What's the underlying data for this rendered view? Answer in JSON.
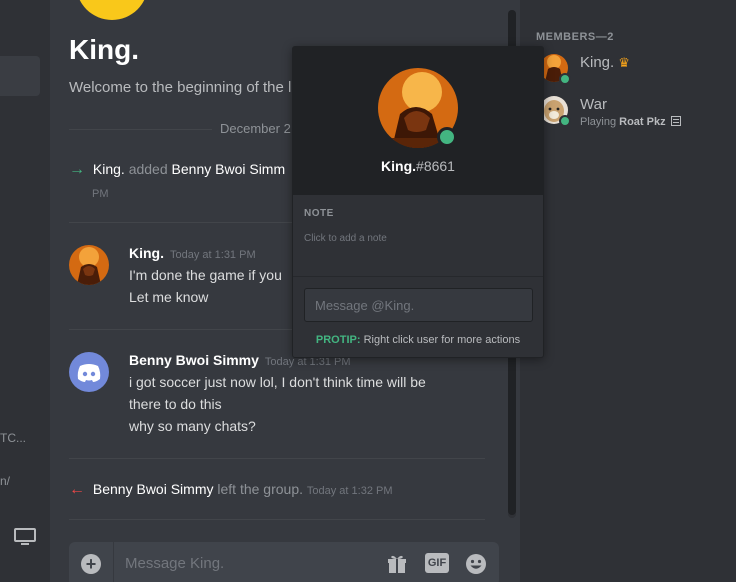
{
  "left_strip": {
    "frag1": "TC...",
    "frag2": "n/"
  },
  "channel": {
    "title": "King.",
    "welcome": "Welcome to the beginning of the l",
    "date_divider": "December 2"
  },
  "system_messages": [
    {
      "arrow": "→",
      "who": "King.",
      "action": "added",
      "target": "Benny Bwoi Simm",
      "time_tail": "PM"
    },
    {
      "arrow": "←",
      "who": "Benny Bwoi Simmy",
      "action": "left the group.",
      "time": "Today at 1:32 PM"
    }
  ],
  "messages": [
    {
      "author": "King.",
      "time": "Today at 1:31 PM",
      "lines": [
        "I'm done the game if you",
        "Let me know"
      ]
    },
    {
      "author": "Benny Bwoi Simmy",
      "time": "Today at 1:31 PM",
      "lines": [
        "i got soccer just now lol, I don't think time will be",
        "there to do this",
        "why so many chats?"
      ]
    }
  ],
  "composer": {
    "placeholder": "Message King.",
    "gif_label": "GIF",
    "plus_icon": "+"
  },
  "members": {
    "header": "MEMBERS—2",
    "list": [
      {
        "name": "King.",
        "badge": "♛"
      },
      {
        "name": "War",
        "activity_prefix": "Playing",
        "activity_game": "Roat Pkz"
      }
    ]
  },
  "popout": {
    "username": "King.",
    "discriminator": "#8661",
    "note_header": "NOTE",
    "note_placeholder": "Click to add a note",
    "message_placeholder": "Message @King.",
    "protip_label": "PROTIP:",
    "protip_text": " Right click user for more actions"
  },
  "colors": {
    "online": "#43b581",
    "background": "#36393f",
    "sidebar": "#2f3136",
    "brand": "#7289da"
  }
}
